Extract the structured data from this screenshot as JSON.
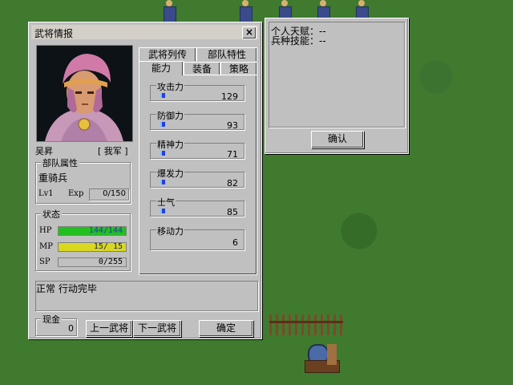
{
  "dialog": {
    "title": "武将情报",
    "close": "×",
    "name": "吴昇",
    "side": "[ 我军 ]",
    "tabs_top": [
      "武将列传",
      "部队特性"
    ],
    "tabs_bottom": [
      "能力",
      "装备",
      "策略"
    ],
    "unit_group_label": "部队属性",
    "unit_type": "重骑兵",
    "level_label": "Lv1",
    "exp_label": "Exp",
    "exp_value": "0/150",
    "status_group_label": "状态",
    "hp_label": "HP",
    "hp_value": "144/144",
    "hp_ratio": 1.0,
    "hp_color": "#20c020",
    "mp_label": "MP",
    "mp_value": "15/ 15",
    "mp_ratio": 1.0,
    "mp_color": "#d8d820",
    "sp_label": "SP",
    "sp_value": "0/255",
    "sp_ratio": 0.0,
    "stats": [
      {
        "label": "攻击力",
        "value": "129"
      },
      {
        "label": "防御力",
        "value": "93"
      },
      {
        "label": "精神力",
        "value": "71"
      },
      {
        "label": "爆发力",
        "value": "82"
      },
      {
        "label": "士气",
        "value": "85"
      }
    ],
    "move_label": "移动力",
    "move_value": "6",
    "status_text": "正常 行动完毕",
    "gold_label": "现金",
    "gold_value": "0",
    "prev_button": "上一武将",
    "next_button": "下一武将",
    "ok_button": "确定"
  },
  "info": {
    "line1": "个人天赋：--",
    "line2": "兵种技能：--",
    "confirm_button": "确认"
  }
}
